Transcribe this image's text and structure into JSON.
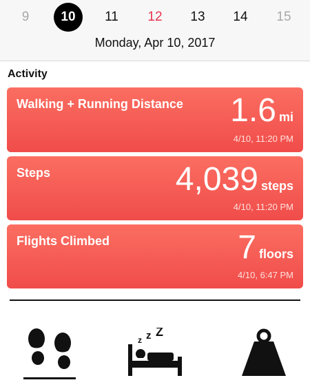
{
  "date_strip": {
    "days": [
      {
        "label": "9",
        "state": "dim"
      },
      {
        "label": "10",
        "state": "selected"
      },
      {
        "label": "11",
        "state": "normal"
      },
      {
        "label": "12",
        "state": "today"
      },
      {
        "label": "13",
        "state": "normal"
      },
      {
        "label": "14",
        "state": "normal"
      },
      {
        "label": "15",
        "state": "dim"
      }
    ],
    "full_date": "Monday, Apr 10, 2017"
  },
  "section_title": "Activity",
  "cards": [
    {
      "title": "Walking + Running Distance",
      "value": "1.6",
      "unit": "mi",
      "time": "4/10, 11:20 PM"
    },
    {
      "title": "Steps",
      "value": "4,039",
      "unit": "steps",
      "time": "4/10, 11:20 PM"
    },
    {
      "title": "Flights Climbed",
      "value": "7",
      "unit": "floors",
      "time": "4/10, 6:47 PM"
    }
  ],
  "tabs": [
    {
      "icon": "footprints-icon",
      "selected": true
    },
    {
      "icon": "sleep-bed-icon",
      "selected": false
    },
    {
      "icon": "weight-icon",
      "selected": false
    }
  ],
  "colors": {
    "card_top": "#fb6e61",
    "card_bottom": "#f04c4a",
    "today": "#e8344e",
    "selected_day_bg": "#000000"
  }
}
